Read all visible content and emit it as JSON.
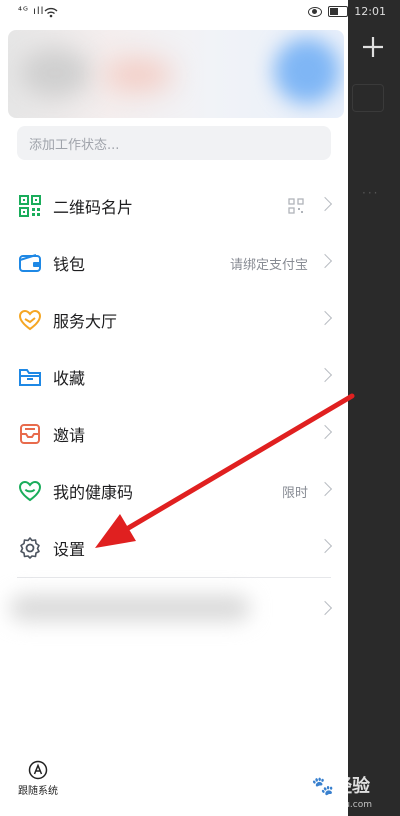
{
  "status_bar": {
    "signal": "⁴ᴳ ıll",
    "time": "12:01"
  },
  "profile": {},
  "work_status": {
    "placeholder": "添加工作状态..."
  },
  "menu": [
    {
      "label": "二维码名片",
      "right_text": "",
      "icon": "qr-code-icon"
    },
    {
      "label": "钱包",
      "right_text": "请绑定支付宝",
      "icon": "wallet-icon"
    },
    {
      "label": "服务大厅",
      "right_text": "",
      "icon": "service-hall-icon"
    },
    {
      "label": "收藏",
      "right_text": "",
      "icon": "folder-icon"
    },
    {
      "label": "邀请",
      "right_text": "",
      "icon": "invite-icon"
    },
    {
      "label": "我的健康码",
      "right_text": "限时",
      "icon": "health-code-icon"
    },
    {
      "label": "设置",
      "right_text": "",
      "icon": "gear-icon"
    }
  ],
  "theme": {
    "label": "跟随系统"
  },
  "watermark": {
    "text": "Bai🐾经验",
    "sub": "jingyan.baidu.com"
  },
  "colors": {
    "green": "#1aad5b",
    "blue": "#1e88e5",
    "orange": "#f5a623",
    "red_arrow": "#e02020",
    "coral": "#e86b4c"
  }
}
